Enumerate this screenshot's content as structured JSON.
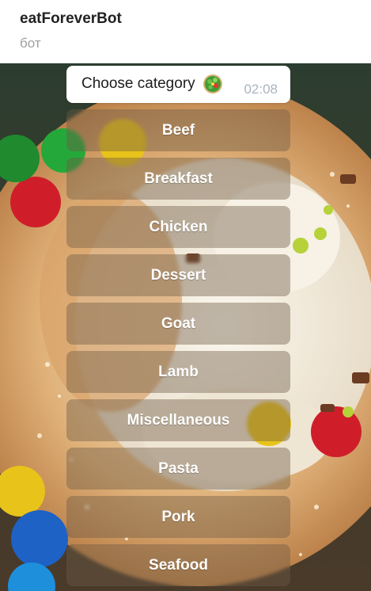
{
  "header": {
    "title": "eatForeverBot",
    "subtitle": "бот"
  },
  "message": {
    "text": "Choose category",
    "emoji": "green-salad-icon",
    "time": "02:08"
  },
  "keyboard": {
    "buttons": [
      {
        "label": "Beef"
      },
      {
        "label": "Breakfast"
      },
      {
        "label": "Chicken"
      },
      {
        "label": "Dessert"
      },
      {
        "label": "Goat"
      },
      {
        "label": "Lamb"
      },
      {
        "label": "Miscellaneous"
      },
      {
        "label": "Pasta"
      },
      {
        "label": "Pork"
      },
      {
        "label": "Seafood"
      }
    ]
  },
  "colors": {
    "header_bg": "#ffffff",
    "bubble_bg": "#ffffff",
    "button_bg": "rgba(110, 90, 70, 0.42)",
    "time_color": "#a8b4bf"
  }
}
